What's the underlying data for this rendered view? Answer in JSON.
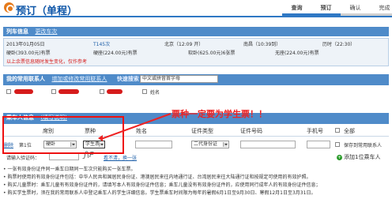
{
  "header": {
    "title": "预订（单程）",
    "steps": [
      {
        "label": "查询",
        "active": true
      },
      {
        "label": "预订",
        "active": true
      },
      {
        "label": "确认",
        "active": false
      },
      {
        "label": "完成",
        "active": false
      }
    ]
  },
  "train": {
    "section_label": "列车信息",
    "change_link": "更改车次",
    "date": "2013年01月05日",
    "train_no": "T145次",
    "from": "北京（12:09 开）",
    "to": "南昌（10:39到）",
    "duration": "历时（22:30）",
    "seats": [
      "硬卧(393.00元)有票",
      "硬座(224.00元)有票",
      "软卧(625.00元)6张票",
      "无座(224.00元)有票"
    ],
    "notice": "以上余票信息随时发生变化，仅作参考"
  },
  "contacts": {
    "section_label": "我的常用联系人",
    "add_link": "增加或修改常用联系人",
    "search_label": "快速搜索",
    "search_placeholder": "中文或拼音首字母",
    "visible_name": "姓名"
  },
  "passengers": {
    "section_label": "乘车人信息",
    "fill_link": "(填写说明)",
    "headers": {
      "seat_col": "席别",
      "ticket_col": "票种",
      "name_col": "姓名",
      "id_type_col": "证件类型",
      "id_no_col": "证件号码",
      "phone_col": "手机号",
      "all": "全部"
    },
    "row": {
      "index": "第1位",
      "seat": "硬卧",
      "ticket_type": "学生票",
      "id_type": "二代身份证",
      "save": "保存到常用联系人"
    },
    "verify_label": "请输入验证码：",
    "verify_link": "看不清，换一张",
    "add_button": "添加1位乘车人"
  },
  "annotation": "票种一定要为学生票！！",
  "notes": [
    "• 一张有效身份证件同一乘车日期同一车次只能购买一张车票。",
    "• 购票时使用的有效身份证件包括：中华人民共和国居民身份证、港澳居民来往内地通行证、台湾居民来往大陆通行证和按规定可使用的有效护照。",
    "• 购买儿童票时：乘车儿童有有效身份证件的，请填写本人有效身份证件信息；乘车儿童没有有效身份证件的，应使用同行成年人的有效身份证件信息；",
    "• 购买学生票时，须在我的常用联系人中登记乘车人的学生详细信息。学生票乘车时间限为每年的暑假6月1日至9月30日、寒假12月1日至3月31日。"
  ],
  "colors": {
    "accent": "#2f78c4",
    "header_bg": "#4f8bc9",
    "warning": "#d61c1c"
  }
}
